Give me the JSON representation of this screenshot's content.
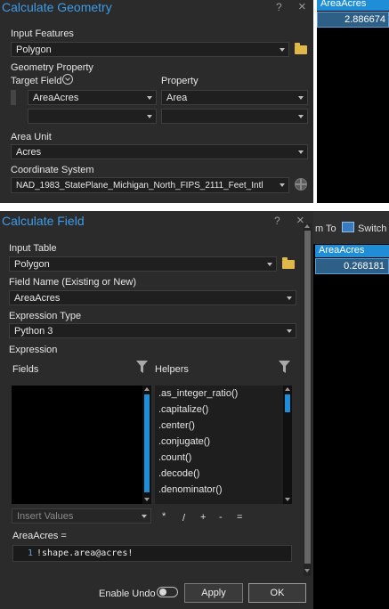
{
  "geometry_dialog": {
    "title": "Calculate Geometry",
    "help_icon": "?",
    "close_icon": "×",
    "input_features_label": "Input Features",
    "input_features_value": "Polygon",
    "geometry_property_label": "Geometry Property",
    "target_field_label": "Target Field",
    "property_label": "Property",
    "row1_target_field": "AreaAcres",
    "row1_property": "Area",
    "area_unit_label": "Area Unit",
    "area_unit_value": "Acres",
    "coordinate_system_label": "Coordinate System",
    "coordinate_system_value": "NAD_1983_StatePlane_Michigan_North_FIPS_2111_Feet_Intl"
  },
  "table_top": {
    "header": "AreaAcres",
    "value": "2.886674"
  },
  "field_dialog": {
    "title": "Calculate Field",
    "help_icon": "?",
    "close_icon": "×",
    "input_table_label": "Input Table",
    "input_table_value": "Polygon",
    "field_name_label": "Field Name (Existing or New)",
    "field_name_value": "AreaAcres",
    "expression_type_label": "Expression Type",
    "expression_type_value": "Python 3",
    "expression_label": "Expression",
    "fields_label": "Fields",
    "helpers_label": "Helpers",
    "helpers": [
      ".as_integer_ratio()",
      ".capitalize()",
      ".center()",
      ".conjugate()",
      ".count()",
      ".decode()",
      ".denominator()"
    ],
    "insert_values_placeholder": "Insert Values",
    "operators": [
      "*",
      "/",
      "+",
      "-",
      "="
    ],
    "expression_target": "AreaAcres =",
    "code_line_number": "1",
    "code_line": "!shape.area@acres!",
    "enable_undo_label": "Enable Undo",
    "apply_label": "Apply",
    "ok_label": "OK"
  },
  "table_bottom": {
    "toolbar_zoom": "m To",
    "toolbar_switch": "Switch",
    "header": "AreaAcres",
    "value": "0.268181"
  }
}
